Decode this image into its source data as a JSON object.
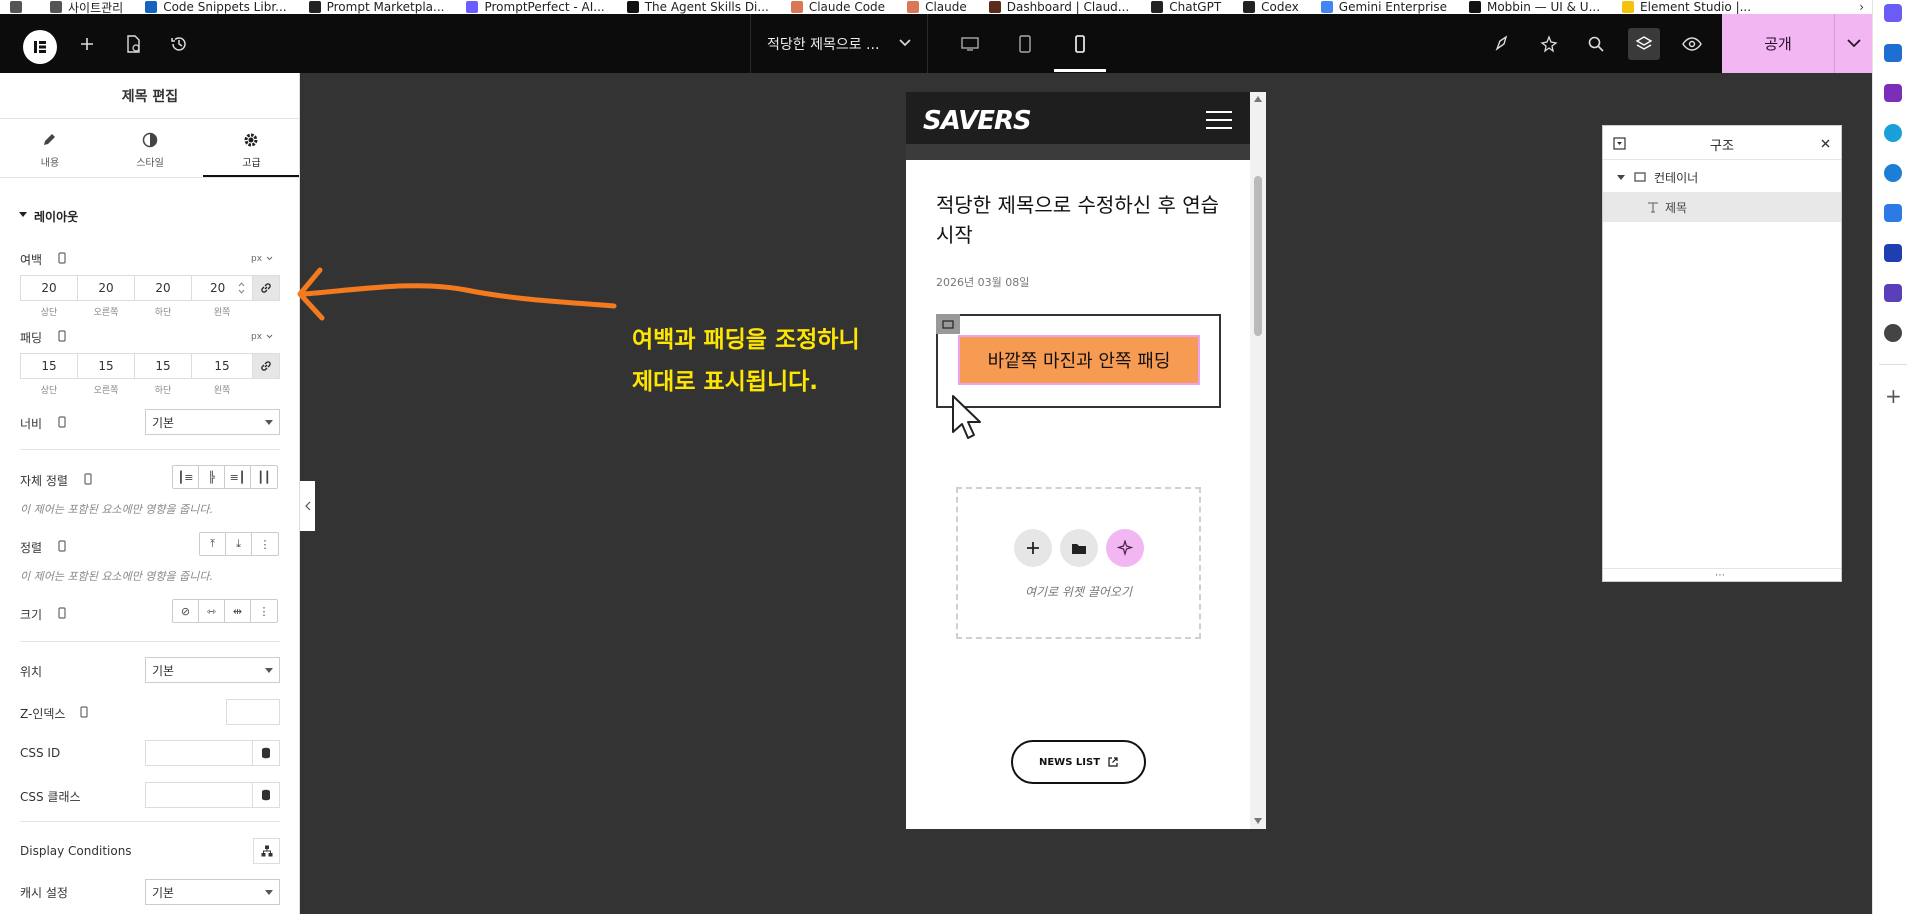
{
  "bookmarks": [
    {
      "label": "",
      "icon": "menu-icon",
      "color": "#555"
    },
    {
      "label": "사이트관리",
      "icon": "folder-icon",
      "color": "#555"
    },
    {
      "label": "Code Snippets Libr...",
      "icon": "code-snippets-icon",
      "color": "#1565c0"
    },
    {
      "label": "Prompt Marketpla...",
      "icon": "prompt-market-icon",
      "color": "#222"
    },
    {
      "label": "PromptPerfect - AI...",
      "icon": "promptperfect-icon",
      "color": "#6a5cff"
    },
    {
      "label": "The Agent Skills Di...",
      "icon": "triangle-icon",
      "color": "#111"
    },
    {
      "label": "Claude Code",
      "icon": "claude-icon",
      "color": "#d97757"
    },
    {
      "label": "Claude",
      "icon": "claude-icon",
      "color": "#d97757"
    },
    {
      "label": "Dashboard | Claud...",
      "icon": "dashboard-icon",
      "color": "#5a2a1a"
    },
    {
      "label": "ChatGPT",
      "icon": "chatgpt-icon",
      "color": "#222"
    },
    {
      "label": "Codex",
      "icon": "codex-icon",
      "color": "#222"
    },
    {
      "label": "Gemini Enterprise",
      "icon": "gemini-icon",
      "color": "#4285f4"
    },
    {
      "label": "Mobbin — UI & U...",
      "icon": "mobbin-icon",
      "color": "#111"
    },
    {
      "label": "Element Studio |...",
      "icon": "element-studio-icon",
      "color": "#f4c20d"
    }
  ],
  "topbar": {
    "page_title": "적당한 제목으로 ...",
    "publish_label": "공개",
    "accent_color": "#f2b6f2"
  },
  "panel": {
    "title": "제목 편집",
    "tabs": [
      {
        "label": "내용",
        "icon": "pencil-icon"
      },
      {
        "label": "스타일",
        "icon": "contrast-icon"
      },
      {
        "label": "고급",
        "icon": "gear-icon"
      }
    ],
    "section_layout": "레이아웃",
    "margin": {
      "label": "여백",
      "unit": "px",
      "values": [
        "20",
        "20",
        "20",
        "20"
      ],
      "sublabels": [
        "상단",
        "오른쪽",
        "하단",
        "왼쪽"
      ]
    },
    "padding": {
      "label": "패딩",
      "unit": "px",
      "values": [
        "15",
        "15",
        "15",
        "15"
      ],
      "sublabels": [
        "상단",
        "오른쪽",
        "하단",
        "왼쪽"
      ]
    },
    "width": {
      "label": "너비",
      "value": "기본"
    },
    "align_self": {
      "label": "자체 정렬",
      "hint": "이 제어는 포함된 요소에만 영향을 줍니다."
    },
    "order": {
      "label": "정렬",
      "hint": "이 제어는 포함된 요소에만 영향을 줍니다."
    },
    "size": {
      "label": "크기"
    },
    "position": {
      "label": "위치",
      "value": "기본"
    },
    "zindex": {
      "label": "Z-인덱스"
    },
    "css_id": {
      "label": "CSS ID"
    },
    "css_class": {
      "label": "CSS 클래스"
    },
    "display_conditions": {
      "label": "Display Conditions"
    },
    "cache": {
      "label": "캐시 설정",
      "value": "기본"
    }
  },
  "annotation": {
    "line1": "여백과 패딩을 조정하니",
    "line2": "제대로 표시됩니다.",
    "arrow_color": "#f47a20",
    "text_color": "#ffe600"
  },
  "canvas": {
    "logo": "SAVERS",
    "heading": "적당한 제목으로 수정하신 후 연습 시작",
    "date": "2026년 03월 08일",
    "orange_button": "바깥쪽 마진과 안쪽 패딩",
    "drop_hint": "여기로 위젯 끌어오기",
    "news_button": "NEWS LIST"
  },
  "structure": {
    "title": "구조",
    "items": [
      {
        "label": "컨테이너",
        "icon": "container-icon"
      },
      {
        "label": "제목",
        "icon": "heading-icon"
      }
    ]
  }
}
